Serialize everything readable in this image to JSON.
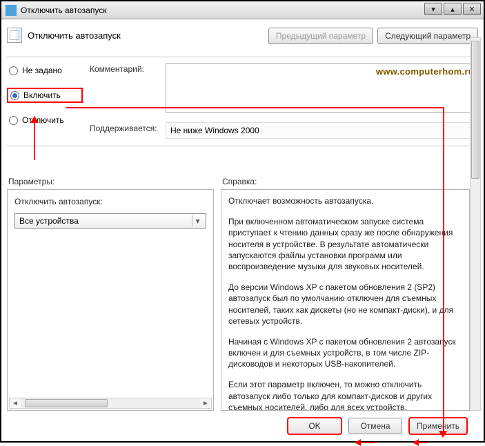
{
  "window": {
    "title": "Отключить автозапуск"
  },
  "header": {
    "policy_title": "Отключить автозапуск",
    "prev_label": "Предыдущий параметр",
    "next_label": "Следующий параметр"
  },
  "watermark": "www.computerhom.ru",
  "radios": {
    "not_configured": "Не задано",
    "enabled": "Включить",
    "disabled": "Отключить",
    "selected": "enabled"
  },
  "form": {
    "comment_label": "Комментарий:",
    "comment_value": "",
    "supported_label": "Поддерживается:",
    "supported_value": "Не ниже Windows 2000"
  },
  "panes": {
    "options_label": "Параметры:",
    "help_label": "Справка:"
  },
  "options": {
    "field_label": "Отключить автозапуск:",
    "selected_value": "Все устройства"
  },
  "help": {
    "p1": "Отключает возможность автозапуска.",
    "p2": "При включенном автоматическом запуске система приступает к чтению данных сразу же после обнаружения носителя в устройстве. В результате автоматически запускаются файлы установки программ или воспроизведение музыки для звуковых носителей.",
    "p3": "До версии Windows XP с пакетом обновления 2 (SP2) автозапуск был по умолчанию отключен для съемных носителей, таких как дискеты (но не компакт-диски), и для сетевых устройств.",
    "p4": "Начиная с Windows XP с пакетом обновления 2 автозапуск включен и для съемных устройств, в том числе ZIP-дисководов и некоторых USB-накопителей.",
    "p5": "Если этот параметр включен, то можно отключить автозапуск либо только для компакт-дисков и других съемных носителей, либо для всех устройств."
  },
  "buttons": {
    "ok": "OK",
    "cancel": "Отмена",
    "apply": "Применить"
  }
}
